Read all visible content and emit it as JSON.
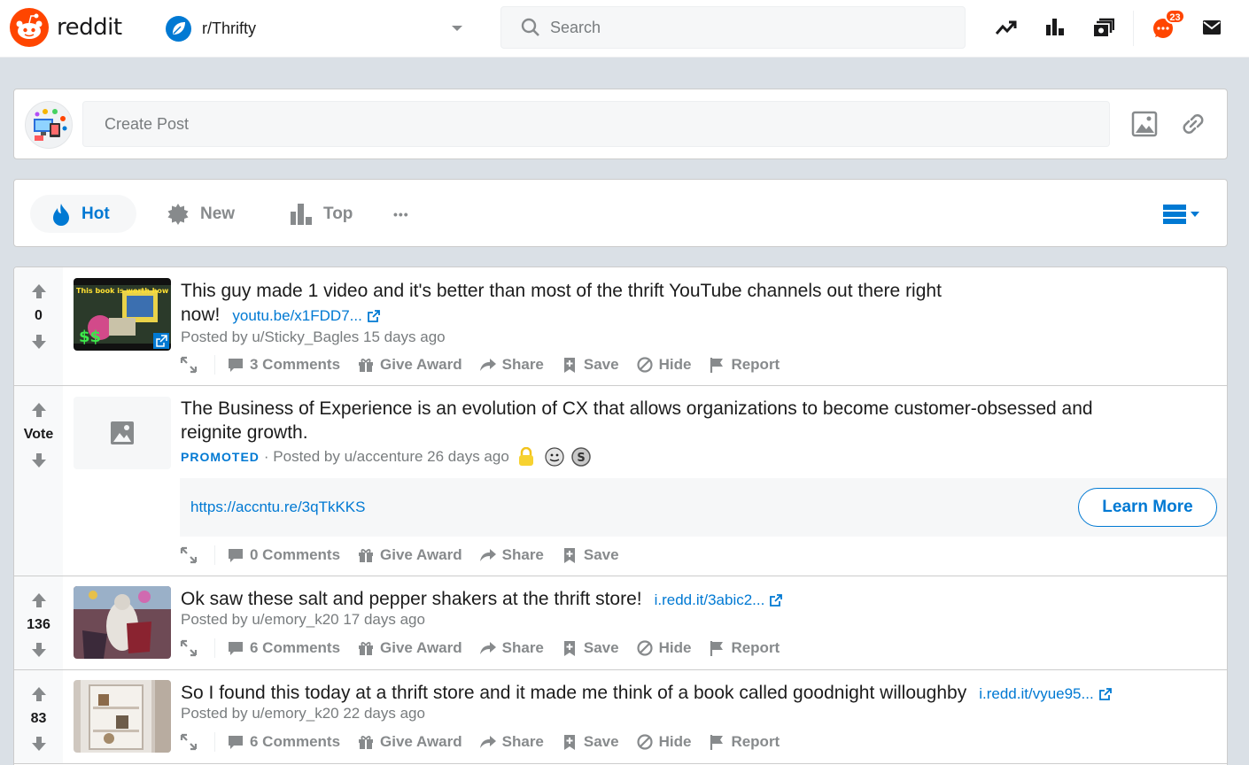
{
  "header": {
    "logo_text": "reddit",
    "community": "r/Thrifty",
    "search_placeholder": "Search",
    "notification_count": "23",
    "icons": [
      "popular-icon",
      "all-icon",
      "reddit-live-icon",
      "chat-icon",
      "messages-icon"
    ]
  },
  "create_post": {
    "placeholder": "Create Post",
    "icons": [
      "image-icon",
      "link-icon"
    ]
  },
  "sort": {
    "hot": "Hot",
    "new": "New",
    "top": "Top",
    "more": "•••"
  },
  "colors": {
    "accent": "#0079d3",
    "brand": "#ff4500",
    "text_muted": "#878a8c"
  },
  "posts": [
    {
      "score": "0",
      "title_line1": "This guy made 1 video and it's better than most of the thrift YouTube channels out there right",
      "title_line2": "now!",
      "link": "youtu.be/x1FDD7...",
      "posted_by": "Posted by u/Sticky_Bagles 15 days ago",
      "thumbnail_text": "This book is worth how much?",
      "actions": {
        "comments": "3 Comments",
        "award": "Give Award",
        "share": "Share",
        "save": "Save",
        "hide": "Hide",
        "report": "Report"
      }
    },
    {
      "score": "Vote",
      "title_line1": "The Business of Experience is an evolution of CX that allows organizations to become customer-obsessed and",
      "title_line2": "reignite growth.",
      "promoted": "PROMOTED",
      "posted_by": "· Posted by u/accenture 26 days ago",
      "ad_url": "https://accntu.re/3qTkKKS",
      "cta": "Learn More",
      "actions": {
        "comments": "0 Comments",
        "award": "Give Award",
        "share": "Share",
        "save": "Save"
      }
    },
    {
      "score": "136",
      "title": "Ok saw these salt and pepper shakers at the thrift store!",
      "link": "i.redd.it/3abic2...",
      "posted_by": "Posted by u/emory_k20 17 days ago",
      "actions": {
        "comments": "6 Comments",
        "award": "Give Award",
        "share": "Share",
        "save": "Save",
        "hide": "Hide",
        "report": "Report"
      }
    },
    {
      "score": "83",
      "title": "So I found this today at a thrift store and it made me think of a book called goodnight willoughby",
      "link": "i.redd.it/vyue95...",
      "posted_by": "Posted by u/emory_k20 22 days ago",
      "actions": {
        "comments": "6 Comments",
        "award": "Give Award",
        "share": "Share",
        "save": "Save",
        "hide": "Hide",
        "report": "Report"
      }
    }
  ]
}
